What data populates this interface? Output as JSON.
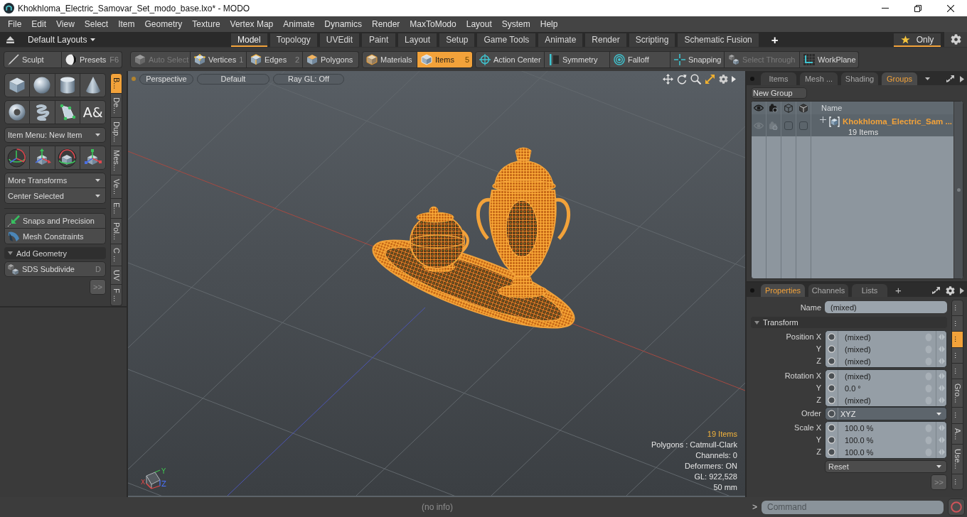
{
  "window": {
    "title": "Khokhloma_Electric_Samovar_Set_modo_base.lxo* - MODO"
  },
  "menu": [
    "File",
    "Edit",
    "View",
    "Select",
    "Item",
    "Geometry",
    "Texture",
    "Vertex Map",
    "Animate",
    "Dynamics",
    "Render",
    "MaxToModo",
    "Layout",
    "System",
    "Help"
  ],
  "layout_bar": {
    "layouts": "Default Layouts",
    "tabs": [
      {
        "label": "Model",
        "selected": true
      },
      {
        "label": "Topology",
        "selected": false
      },
      {
        "label": "UVEdit",
        "selected": false
      },
      {
        "label": "Paint",
        "selected": false
      },
      {
        "label": "Layout",
        "selected": false
      },
      {
        "label": "Setup",
        "selected": false
      },
      {
        "label": "Game Tools",
        "selected": false
      },
      {
        "label": "Animate",
        "selected": false
      },
      {
        "label": "Render",
        "selected": false
      },
      {
        "label": "Scripting",
        "selected": false
      },
      {
        "label": "Schematic Fusion",
        "selected": false
      }
    ],
    "add_tab": "+",
    "favorites": {
      "label": "Only",
      "on": true
    }
  },
  "toolbar": {
    "palette": [
      {
        "label": "Sculpt"
      },
      {
        "label": "Presets",
        "shortcut": "F6"
      }
    ],
    "groups": [
      [
        {
          "label": "Auto Select",
          "selected": false,
          "disabled": true
        },
        {
          "label": "Vertices",
          "shortcut": "1",
          "selected": false,
          "disabled": false
        },
        {
          "label": "Edges",
          "shortcut": "2",
          "selected": false,
          "disabled": false
        },
        {
          "label": "Polygons",
          "selected": false,
          "disabled": false
        }
      ],
      [
        {
          "label": "Materials",
          "selected": false,
          "disabled": false
        },
        {
          "label": "Items",
          "shortcut": "5",
          "selected": true,
          "disabled": false
        }
      ],
      [
        {
          "label": "Action Center",
          "selected": false,
          "disabled": false
        },
        {
          "label": "Symmetry",
          "selected": false,
          "disabled": false
        },
        {
          "label": "Falloff",
          "selected": false,
          "disabled": false
        },
        {
          "label": "Snapping",
          "selected": false,
          "disabled": false
        },
        {
          "label": "Select Through",
          "selected": false,
          "disabled": true
        },
        {
          "label": "WorkPlane",
          "selected": false,
          "disabled": false
        }
      ]
    ]
  },
  "left_palette": {
    "text_tool_glyph": "A&",
    "item_menu": "Item Menu: New Item",
    "transform_menus": [
      "More Transforms",
      "Center Selected"
    ],
    "tools": [
      "Snaps and Precision",
      "Mesh Constraints"
    ],
    "section": {
      "label": "Add Geometry",
      "expanded": true
    },
    "section_tools": [
      {
        "label": "SDS Subdivide",
        "shortcut": "D"
      }
    ],
    "more": ">>",
    "side_tabs": [
      {
        "label": "B...",
        "selected": true
      },
      {
        "label": "De...",
        "selected": false
      },
      {
        "label": "Dup...",
        "selected": false
      },
      {
        "label": "Mes...",
        "selected": false
      },
      {
        "label": "Ve...",
        "selected": false
      },
      {
        "label": "E...",
        "selected": false
      },
      {
        "label": "Pol...",
        "selected": false
      },
      {
        "label": "C ...",
        "selected": false
      },
      {
        "label": "UV",
        "selected": false
      },
      {
        "label": "F ...",
        "selected": false
      }
    ]
  },
  "viewport": {
    "view_buttons": [
      "Perspective",
      "Default",
      "Ray GL: Off"
    ],
    "stats": [
      {
        "text": "19 Items",
        "highlight": true
      },
      {
        "text": "Polygons : Catmull-Clark",
        "highlight": false
      },
      {
        "text": "Channels: 0",
        "highlight": false
      },
      {
        "text": "Deformers: ON",
        "highlight": false
      },
      {
        "text": "GL: 922,528",
        "highlight": false
      },
      {
        "text": "50 mm",
        "highlight": false
      }
    ],
    "axes": {
      "x": "X",
      "y": "Y",
      "z": "Z"
    }
  },
  "groups_panel": {
    "tabs": [
      {
        "label": "Items",
        "selected": false
      },
      {
        "label": "Mesh ...",
        "selected": false
      },
      {
        "label": "Shading",
        "selected": false
      },
      {
        "label": "Groups",
        "selected": true
      }
    ],
    "new_group": "New Group",
    "name_column": "Name",
    "rows": [
      {
        "name": "Khokhloma_Electric_Sam ...",
        "count": "19 Items",
        "selected": true,
        "expanded": false,
        "visible": true,
        "render": true,
        "checks": [
          false,
          false
        ]
      }
    ]
  },
  "properties": {
    "tabs": [
      {
        "label": "Properties",
        "selected": true
      },
      {
        "label": "Channels",
        "selected": false
      },
      {
        "label": "Lists",
        "selected": false
      }
    ],
    "add_tab": "+",
    "name": {
      "label": "Name",
      "value": "(mixed)"
    },
    "section": {
      "label": "Transform",
      "expanded": true
    },
    "groups": [
      {
        "kind": "vector",
        "rows": [
          {
            "label": "Position X",
            "value": "(mixed)"
          },
          {
            "label": "Y",
            "value": "(mixed)"
          },
          {
            "label": "Z",
            "value": "(mixed)"
          }
        ]
      },
      {
        "kind": "vector",
        "rows": [
          {
            "label": "Rotation X",
            "value": "(mixed)"
          },
          {
            "label": "Y",
            "value": "0.0 °"
          },
          {
            "label": "Z",
            "value": "(mixed)"
          }
        ]
      },
      {
        "kind": "choice",
        "rows": [
          {
            "label": "Order",
            "value": "XYZ"
          }
        ]
      },
      {
        "kind": "vector",
        "rows": [
          {
            "label": "Scale X",
            "value": "100.0 %"
          },
          {
            "label": "Y",
            "value": "100.0 %"
          },
          {
            "label": "Z",
            "value": "100.0 %"
          }
        ]
      }
    ],
    "reset": "Reset",
    "more": ">>",
    "side_tabs": [
      {
        "label": "...",
        "selected": false
      },
      {
        "label": "...",
        "selected": false
      },
      {
        "label": "...",
        "selected": true
      },
      {
        "label": "...",
        "selected": false
      },
      {
        "label": "...",
        "selected": false
      },
      {
        "label": "Gro...",
        "selected": false
      },
      {
        "label": "...",
        "selected": false
      },
      {
        "label": "A...",
        "selected": false
      },
      {
        "label": "Use...",
        "selected": false
      },
      {
        "label": "...",
        "selected": false
      }
    ]
  },
  "status_bar": {
    "info": "(no info)",
    "prompt": ">",
    "command_placeholder": "Command"
  }
}
